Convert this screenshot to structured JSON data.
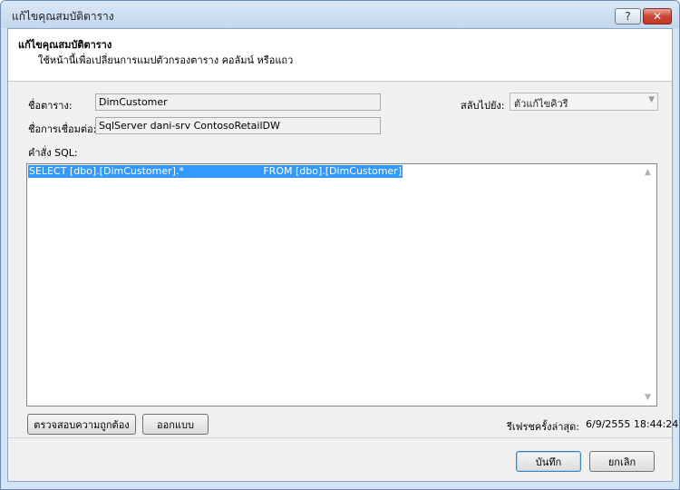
{
  "window": {
    "title": "แก้ไขคุณสมบัติตาราง",
    "help_label": "?",
    "close_label": "✕"
  },
  "header": {
    "title": "แก้ไขคุณสมบัติตาราง",
    "subtitle": "ใช้หน้านี้เพื่อเปลี่ยนการแมปตัวกรองตาราง คอลัมน์ หรือแถว"
  },
  "fields": {
    "table_name_label": "ชื่อตาราง:",
    "table_name_value": "DimCustomer",
    "connection_label": "ชื่อการเชื่อมต่อ:",
    "connection_value": "SqlServer dani-srv ContosoRetailDW",
    "switch_label": "สลับไปยัง:",
    "switch_value": "ตัวแก้ไขคิวรี",
    "sql_label": "คำสั่ง SQL:"
  },
  "sql": {
    "query": "SELECT [dbo].[DimCustomer].*                         FROM [dbo].[DimCustomer]"
  },
  "actions": {
    "validate_label": "ตรวจสอบความถูกต้อง",
    "design_label": "ออกแบบ",
    "last_refresh_label": "รีเฟรชครั้งล่าสุด:",
    "last_refresh_value": "6/9/2555 18:44:24",
    "save_label": "บันทึก",
    "cancel_label": "ยกเลิก"
  },
  "icons": {
    "help": "help-icon",
    "close": "close-icon",
    "dropdown": "chevron-down-icon",
    "scroll_up": "scroll-up-icon",
    "scroll_down": "scroll-down-icon"
  },
  "colors": {
    "selection": "#3399ff",
    "close_button": "#c94735",
    "title_bar": "#c3d7ee"
  }
}
